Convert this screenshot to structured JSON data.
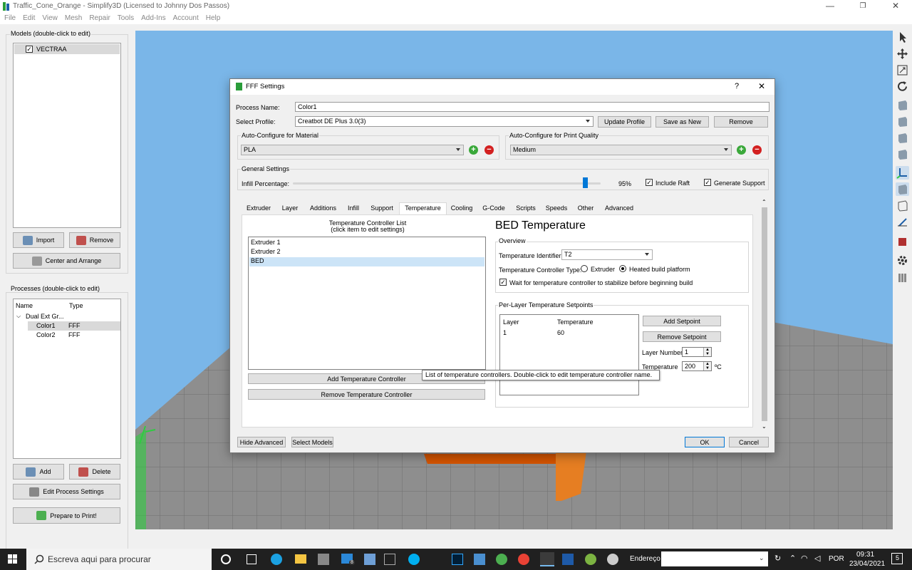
{
  "window": {
    "title": "Traffic_Cone_Orange - Simplify3D (Licensed to Johnny Dos Passos)",
    "controls": [
      "—",
      "❐",
      "✕"
    ]
  },
  "menu": [
    "File",
    "Edit",
    "View",
    "Mesh",
    "Repair",
    "Tools",
    "Add-Ins",
    "Account",
    "Help"
  ],
  "models": {
    "label": "Models (double-click to edit)",
    "items": [
      {
        "name": "VECTRAA",
        "checked": true
      }
    ],
    "import_label": "Import",
    "remove_label": "Remove",
    "center_label": "Center and Arrange"
  },
  "processes": {
    "label": "Processes (double-click to edit)",
    "columns": [
      "Name",
      "Type"
    ],
    "group": "Dual Ext Gr...",
    "rows": [
      {
        "name": "Color1",
        "type": "FFF"
      },
      {
        "name": "Color2",
        "type": "FFF"
      }
    ],
    "add_label": "Add",
    "delete_label": "Delete",
    "edit_label": "Edit Process Settings",
    "prepare_label": "Prepare to Print!"
  },
  "dialog": {
    "title": "FFF Settings",
    "help": "?",
    "close": "✕",
    "process_name_label": "Process Name:",
    "process_name_value": "Color1",
    "select_profile_label": "Select Profile:",
    "profile_value": "Creatbot DE Plus 3.0(3)",
    "update_profile": "Update Profile",
    "save_as_new": "Save as New",
    "remove": "Remove",
    "auto_material_label": "Auto-Configure for Material",
    "material_value": "PLA",
    "auto_quality_label": "Auto-Configure for Print Quality",
    "quality_value": "Medium",
    "general_settings_label": "General Settings",
    "infill_label": "Infill Percentage:",
    "infill_value": "95%",
    "infill_fraction": 0.95,
    "include_raft": "Include Raft",
    "generate_support": "Generate Support",
    "tabs": [
      "Extruder",
      "Layer",
      "Additions",
      "Infill",
      "Support",
      "Temperature",
      "Cooling",
      "G-Code",
      "Scripts",
      "Speeds",
      "Other",
      "Advanced"
    ],
    "active_tab": "Temperature",
    "controller_list_title": "Temperature Controller List",
    "controller_list_subtitle": "(click item to edit settings)",
    "controllers": [
      "Extruder 1",
      "Extruder 2",
      "BED"
    ],
    "selected_controller": "BED",
    "add_controller": "Add Temperature Controller",
    "remove_controller": "Remove Temperature Controller",
    "tooltip": "List of temperature controllers.  Double-click to edit temperature controller name.",
    "heading": "BED Temperature",
    "overview_label": "Overview",
    "temp_identifier_label": "Temperature Identifier",
    "temp_identifier_value": "T2",
    "controller_type_label": "Temperature Controller Type:",
    "type_extruder": "Extruder",
    "type_heated_bed": "Heated build platform",
    "wait_label": "Wait for temperature controller to stabilize before beginning build",
    "setpoints_label": "Per-Layer Temperature Setpoints",
    "setpoint_columns": [
      "Layer",
      "Temperature"
    ],
    "setpoint_rows": [
      {
        "layer": "1",
        "temperature": "60"
      }
    ],
    "add_setpoint": "Add Setpoint",
    "remove_setpoint": "Remove Setpoint",
    "layer_number_label": "Layer Number",
    "layer_number_value": "1",
    "temperature_label": "Temperature",
    "temperature_value": "200",
    "temperature_unit": "ºC",
    "hide_advanced": "Hide Advanced",
    "select_models": "Select Models",
    "ok": "OK",
    "cancel": "Cancel"
  },
  "taskbar": {
    "search_placeholder": "Escreva aqui para procurar",
    "address_label": "Endereço",
    "language": "POR",
    "time": "09:31",
    "date": "23/04/2021",
    "notification_count": "5",
    "mail_badge": "8"
  }
}
